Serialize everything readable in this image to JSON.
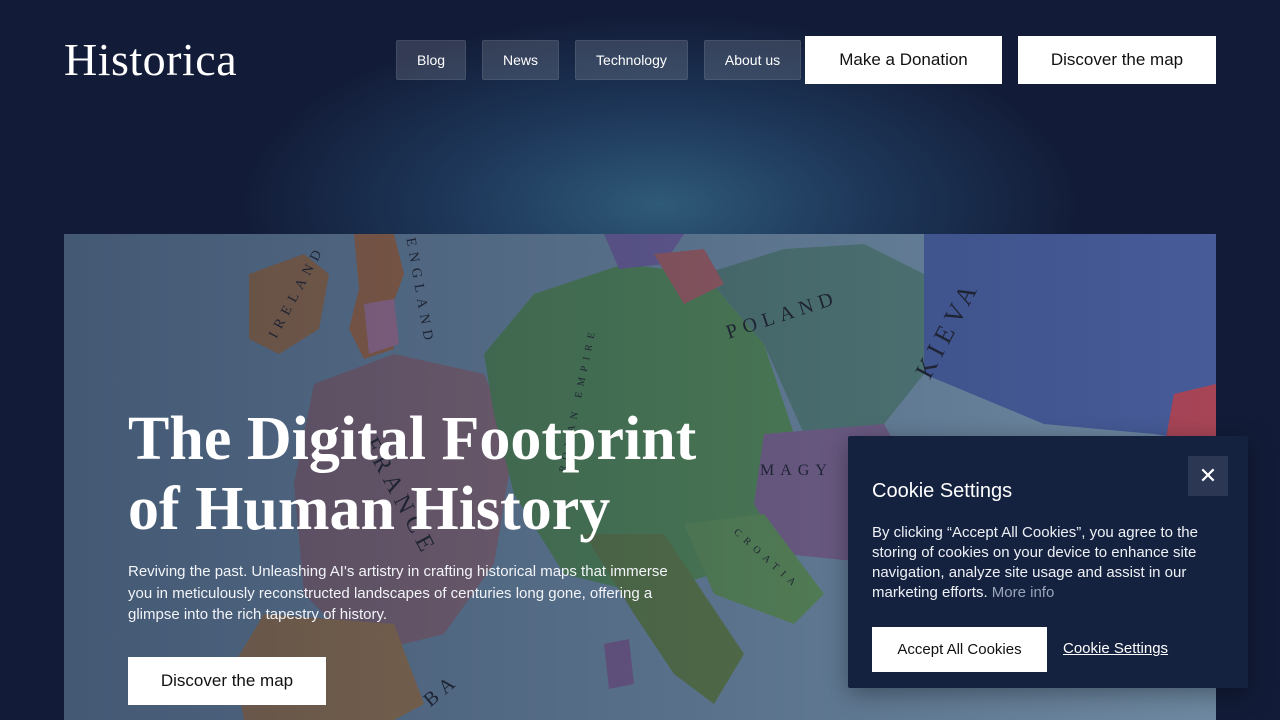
{
  "header": {
    "logo_text": "Historica",
    "nav": [
      "Blog",
      "News",
      "Technology",
      "About us"
    ],
    "donate_label": "Make a Donation",
    "discover_label": "Discover the map"
  },
  "hero": {
    "title_line1": "The Digital Footprint",
    "title_line2": "of Human History",
    "subtitle": "Reviving the past. Unleashing AI's artistry in crafting historical maps that immerse you in meticulously reconstructed landscapes of centuries long gone, offering a glimpse into the rich tapestry of history.",
    "cta_label": "Discover the map",
    "map_labels": {
      "ireland": "IRELAND",
      "england": "ENGLAND",
      "poland": "POLAND",
      "kiev": "KIEVA",
      "empire": "ROMAN EMPIRE",
      "magy": "MAGY",
      "croatia": "CROATIA",
      "france": "FRANCE",
      "ba": "BA"
    }
  },
  "cookie": {
    "title": "Cookie Settings",
    "close_glyph": "✕",
    "text": "By clicking “Accept All Cookies”, you agree to the storing of cookies on your device to enhance site navigation, analyze site usage and assist in our marketing efforts.",
    "more_info": "More info",
    "accept_label": "Accept All Cookies",
    "settings_label": "Cookie Settings"
  },
  "colors": {
    "background": "#121c38",
    "dialog": "#15223f",
    "map_sea": "#7e9bb3"
  }
}
